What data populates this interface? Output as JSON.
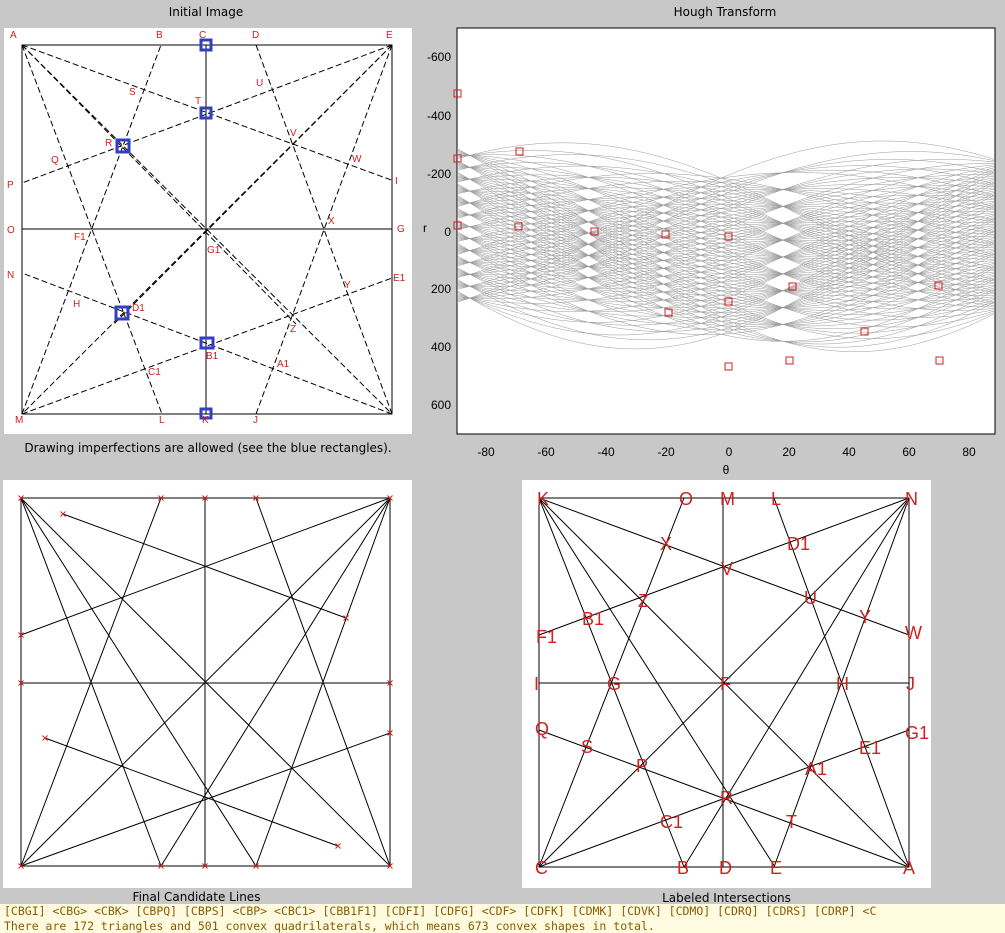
{
  "panels": {
    "initial_title": "Initial Image",
    "hough_title": "Hough Transform",
    "initial_caption": "Drawing imperfections are allowed (see the blue rectangles).",
    "final_title": "Final Candidate Lines",
    "labeled_title": "Labeled Intersections"
  },
  "initial_labels": [
    "A",
    "B",
    "C",
    "D",
    "E",
    "S",
    "U",
    "T",
    "V",
    "R",
    "W",
    "Q",
    "P",
    "I",
    "O",
    "F1",
    "X",
    "G",
    "G1",
    "N",
    "H",
    "E1",
    "D1",
    "Y",
    "Z",
    "B1",
    "C1",
    "A1",
    "M",
    "L",
    "K",
    "J"
  ],
  "labeled_labels": [
    "K",
    "O",
    "M",
    "L",
    "N",
    "X",
    "D1",
    "V",
    "Z",
    "U",
    "B1",
    "Y",
    "W",
    "F1",
    "I",
    "G",
    "F",
    "H",
    "J",
    "Q",
    "G1",
    "S",
    "E1",
    "P",
    "A1",
    "R",
    "C1",
    "T",
    "C",
    "B",
    "D",
    "E",
    "A"
  ],
  "hough": {
    "theta_ticks": [
      "-80",
      "-60",
      "-40",
      "-20",
      "0",
      "20",
      "40",
      "60",
      "80"
    ],
    "r_ticks": [
      "-600",
      "-400",
      "-200",
      "0",
      "200",
      "400",
      "600"
    ],
    "xlabel": "θ",
    "ylabel": "r"
  },
  "console": {
    "line1": "[CBGI] <CBG> <CBK> [CBPQ] [CBPS] <CBP> <CBC1> [CBB1F1] [CDFI] [CDFG] <CDF> [CDFK] [CDMK] [CDVK] [CDMO] [CDRQ] [CDRS] [CDRP] <C",
    "line2": "There are 172 triangles and 501 convex quadrilaterals, which means 673 convex shapes in total."
  },
  "colors": {
    "label_red": "#d02020",
    "marker_blue": "#3040c0"
  }
}
